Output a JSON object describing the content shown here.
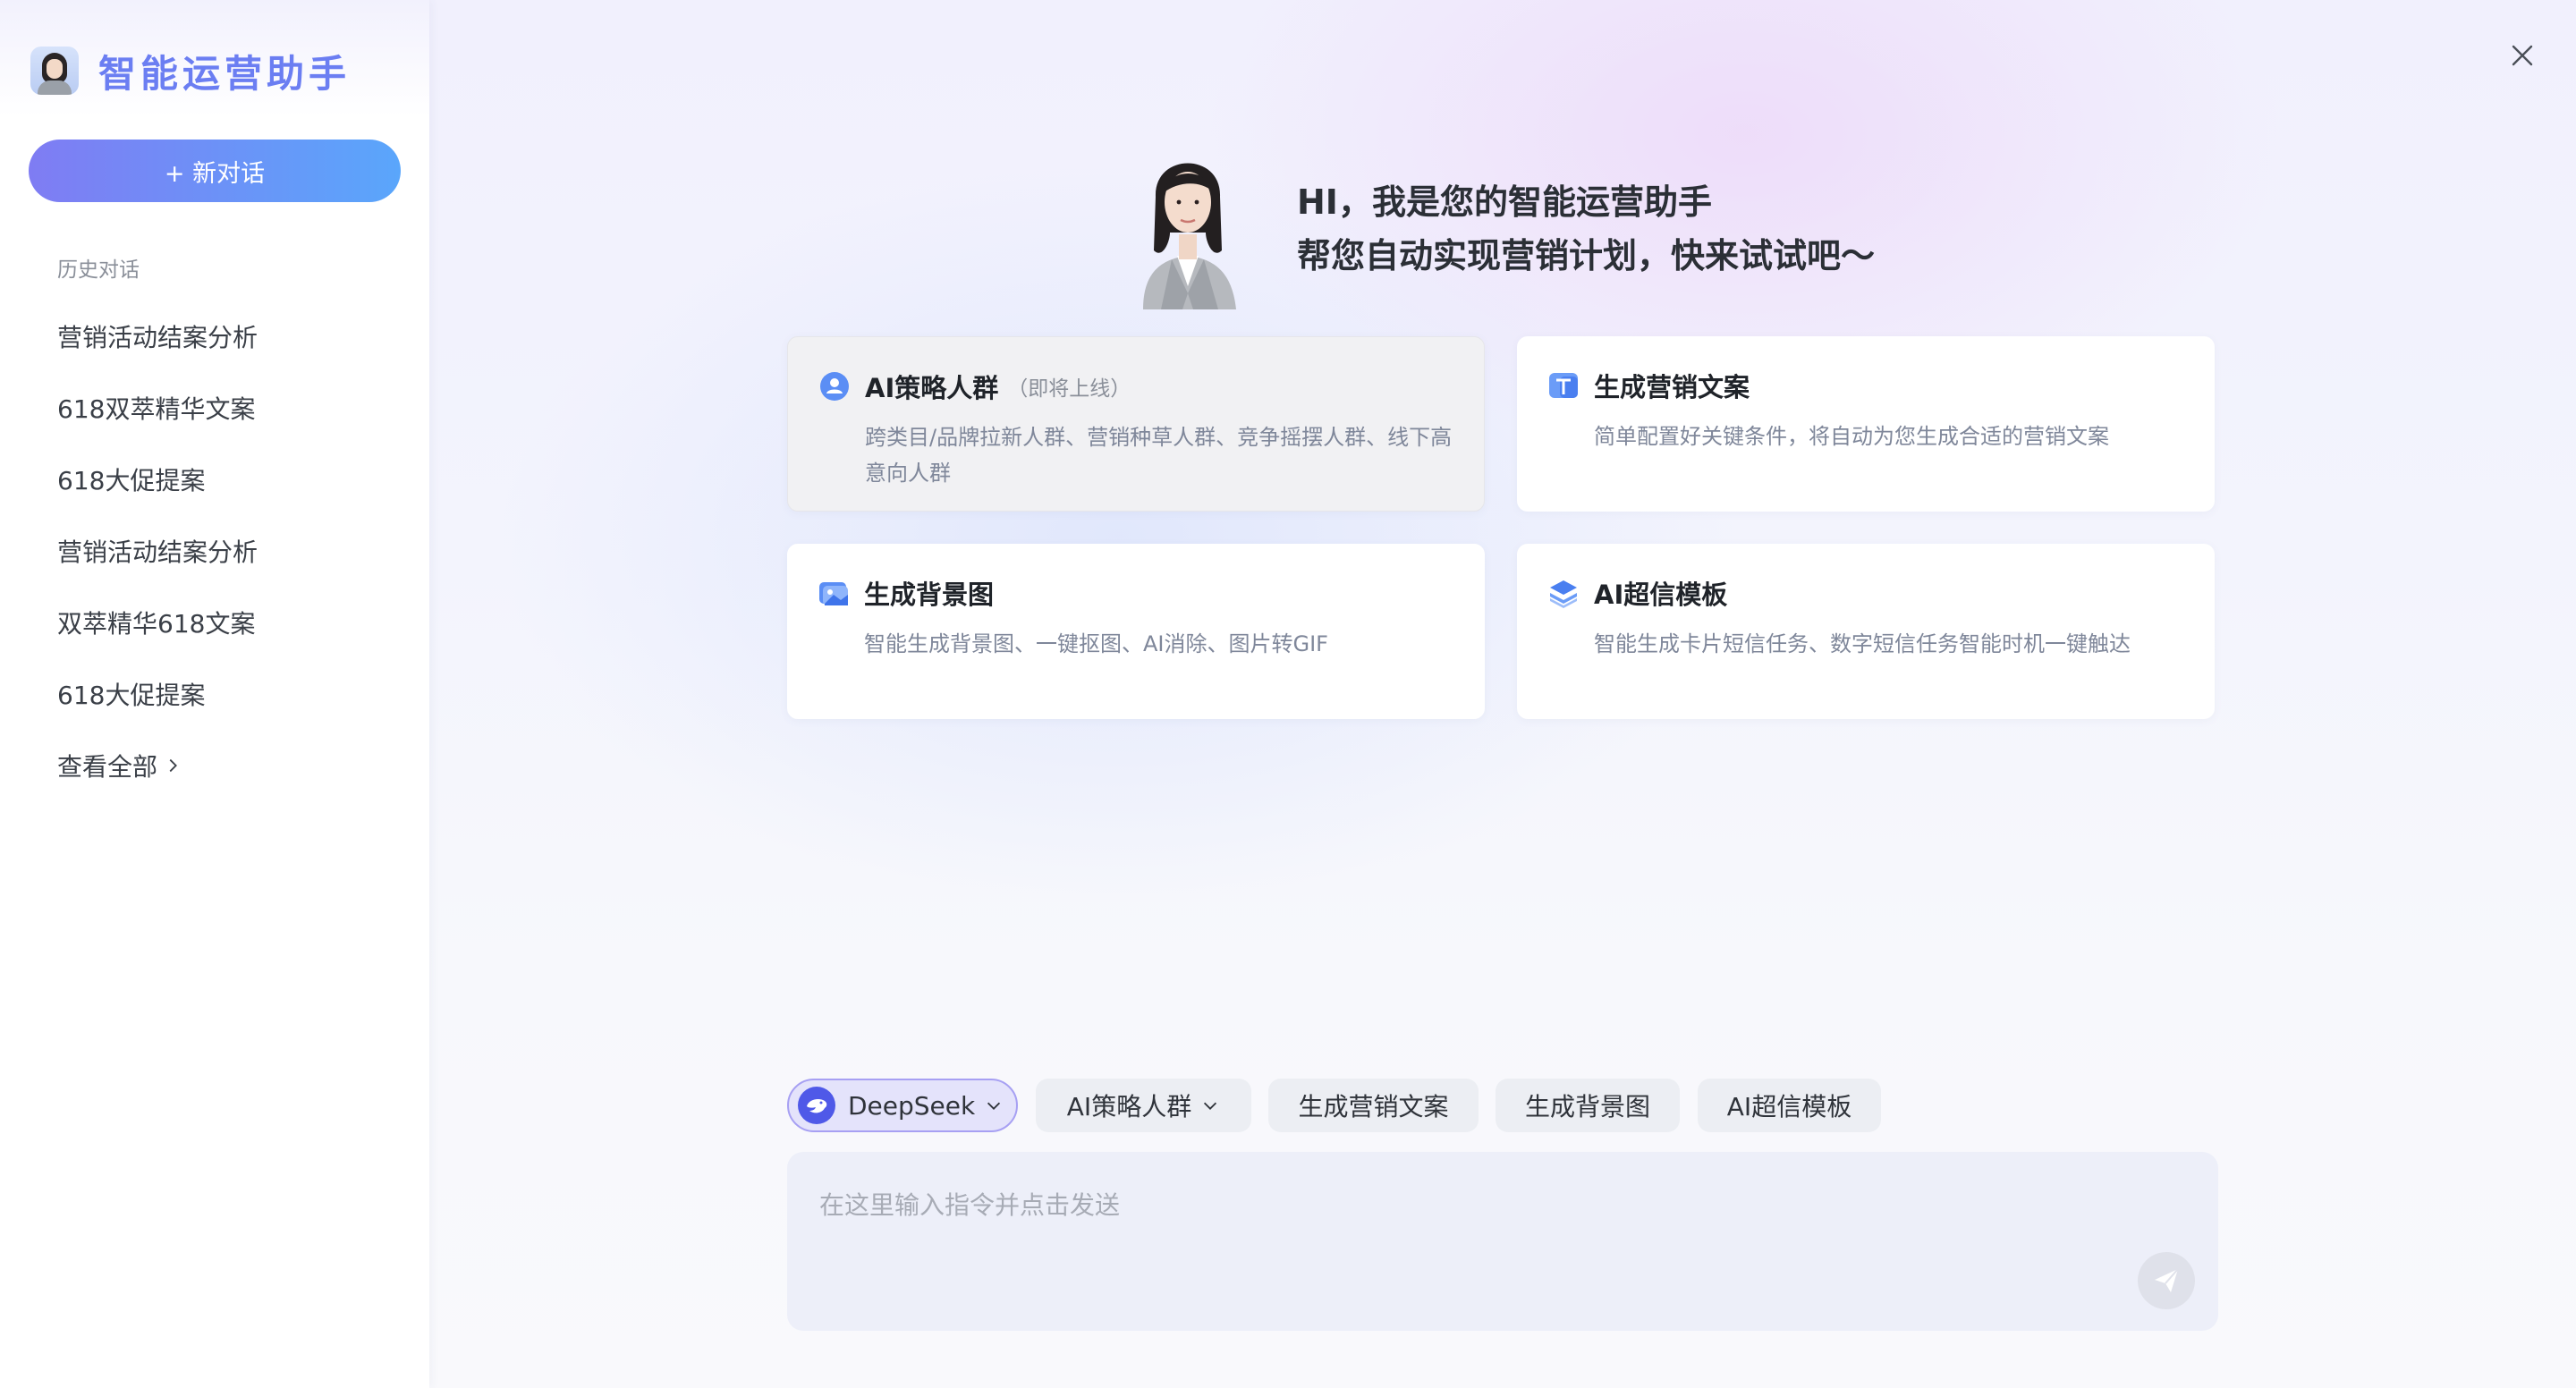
{
  "sidebar": {
    "title": "智能运营助手",
    "new_chat_label": "+ 新对话",
    "history_label": "历史对话",
    "history_items": [
      "营销活动结案分析",
      "618双萃精华文案",
      "618大促提案",
      "营销活动结案分析",
      "双萃精华618文案",
      "618大促提案"
    ],
    "view_all_label": "查看全部"
  },
  "hero": {
    "line1": "HI，我是您的智能运营助手",
    "line2": "帮您自动实现营销计划，快来试试吧～"
  },
  "cards": [
    {
      "title": "AI策略人群",
      "tag": "（即将上线）",
      "desc": "跨类目/品牌拉新人群、营销种草人群、竞争摇摆人群、线下高意向人群",
      "icon": "people-icon",
      "disabled": true
    },
    {
      "title": "生成营销文案",
      "desc": "简单配置好关键条件，将自动为您生成合适的营销文案",
      "icon": "text-icon"
    },
    {
      "title": "生成背景图",
      "desc": "智能生成背景图、一键抠图、AI消除、图片转GIF",
      "icon": "image-icon"
    },
    {
      "title": "AI超信模板",
      "desc": "智能生成卡片短信任务、数字短信任务智能时机一键触达",
      "icon": "layers-icon"
    }
  ],
  "chips": {
    "model": "DeepSeek",
    "strategy": "AI策略人群",
    "copy": "生成营销文案",
    "background": "生成背景图",
    "sms": "AI超信模板"
  },
  "input": {
    "placeholder": "在这里输入指令并点击发送"
  },
  "colors": {
    "brand": "#6b7ef2",
    "button_start": "#7f7cf3",
    "button_end": "#5aa6fb",
    "deepseek": "#4f59e8"
  }
}
